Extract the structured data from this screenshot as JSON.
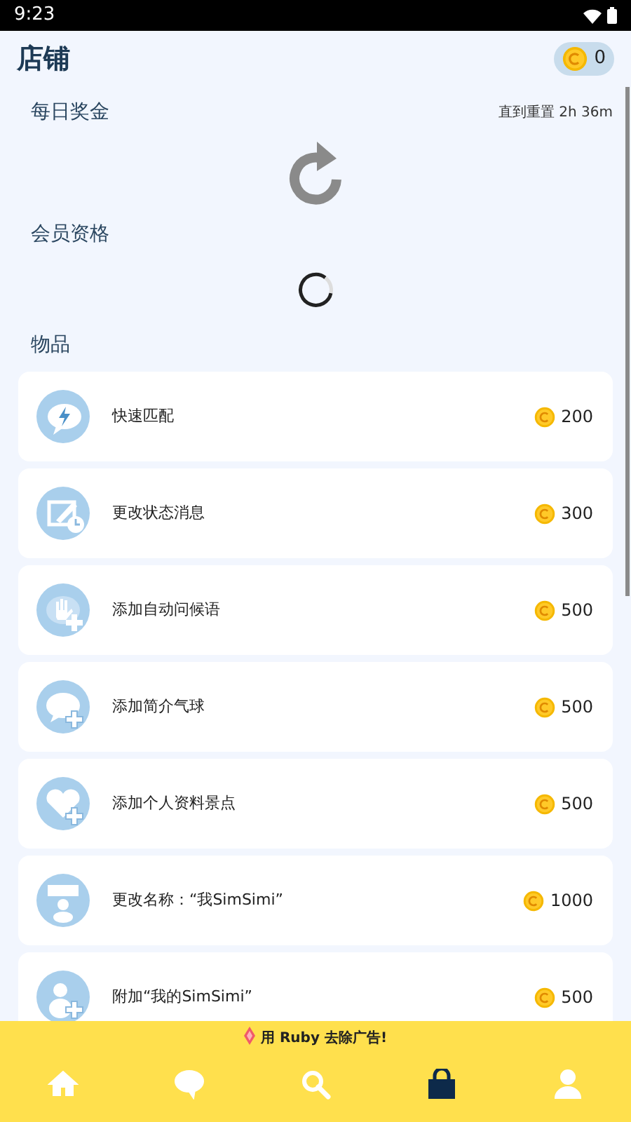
{
  "status_bar": {
    "time": "9:23"
  },
  "header": {
    "title": "店铺",
    "coins": "0"
  },
  "daily_bonus": {
    "title": "每日奖金",
    "reset": "直到重置 2h 36m"
  },
  "membership": {
    "title": "会员资格"
  },
  "items_section": {
    "title": "物品"
  },
  "items": [
    {
      "kind": "lightning",
      "name": "快速匹配",
      "price": "200"
    },
    {
      "kind": "status",
      "name": "更改状态消息",
      "price": "300"
    },
    {
      "kind": "greeting",
      "name": "添加自动问候语",
      "price": "500"
    },
    {
      "kind": "bubble",
      "name": "添加简介气球",
      "price": "500"
    },
    {
      "kind": "heart",
      "name": "添加个人资料景点",
      "price": "500"
    },
    {
      "kind": "nametag",
      "name": "更改名称：“我SimSimi”",
      "price": "1000"
    },
    {
      "kind": "person",
      "name": "附加“我的SimSimi”",
      "price": "500"
    }
  ],
  "ad_banner": "用 Ruby 去除广告!",
  "nav": [
    {
      "kind": "home",
      "selected": false
    },
    {
      "kind": "chat",
      "selected": false
    },
    {
      "kind": "search",
      "selected": false
    },
    {
      "kind": "shop",
      "selected": true
    },
    {
      "kind": "profile",
      "selected": false
    }
  ]
}
